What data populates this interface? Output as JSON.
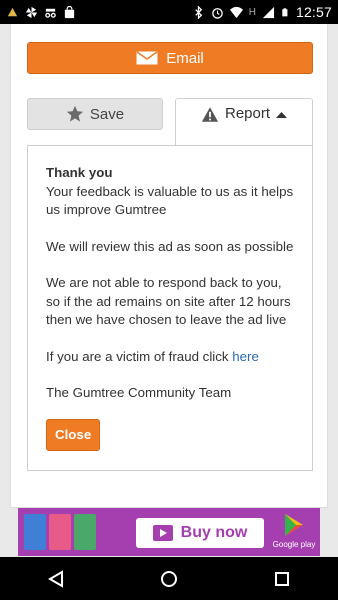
{
  "status_bar": {
    "time": "12:57",
    "network_label": "H"
  },
  "buttons": {
    "email_label": "Email",
    "save_label": "Save",
    "report_label": "Report",
    "close_label": "Close"
  },
  "panel": {
    "title": "Thank you",
    "line1": "Your feedback is valuable to us as it helps us improve Gumtree",
    "line2": "We will review this ad as soon as possible",
    "line3": "We are not able to respond back to you, so if the ad remains on site after 12 hours then we have chosen to leave the ad live",
    "fraud_text": "If you are a victim of fraud click ",
    "fraud_link": "here",
    "signature": "The Gumtree Community Team"
  },
  "ad": {
    "buy_label": "Buy now",
    "store_label": "Google play"
  },
  "colors": {
    "accent": "#ef7b24",
    "link": "#2c68b3",
    "ad_bg": "#a53fb0"
  }
}
